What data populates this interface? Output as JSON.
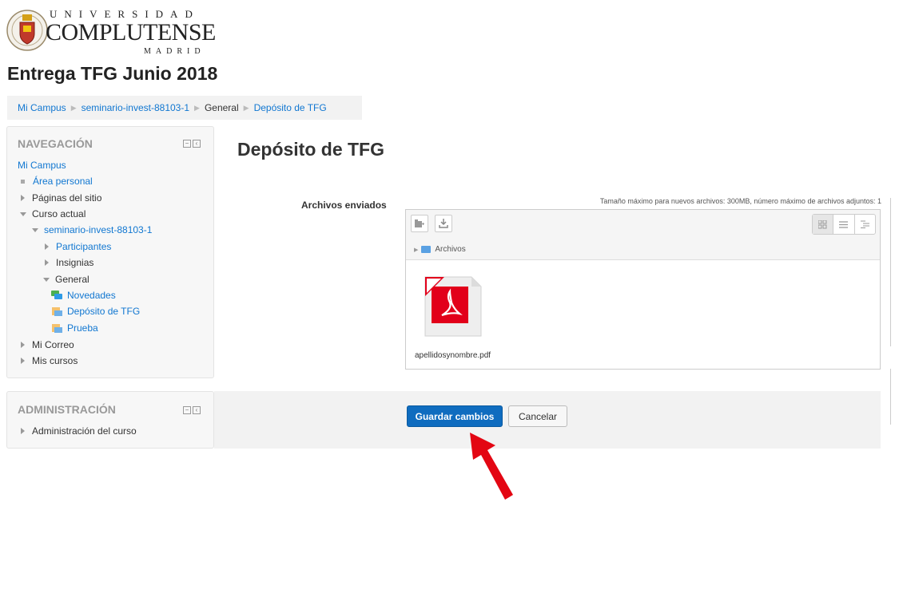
{
  "header": {
    "logo_line1": "UNIVERSIDAD",
    "logo_line2": "COMPLUTENSE",
    "logo_line3": "MADRID",
    "page_title": "Entrega TFG Junio 2018"
  },
  "breadcrumb": {
    "items": [
      "Mi Campus",
      "seminario-invest-88103-1",
      "General",
      "Depósito de TFG"
    ]
  },
  "navigation": {
    "title": "NAVEGACIÓN",
    "items": [
      {
        "label": "Mi Campus"
      },
      {
        "label": "Área personal"
      },
      {
        "label": "Páginas del sitio"
      },
      {
        "label": "Curso actual"
      },
      {
        "label": "seminario-invest-88103-1"
      },
      {
        "label": "Participantes"
      },
      {
        "label": "Insignias"
      },
      {
        "label": "General"
      },
      {
        "label": "Novedades",
        "icon": "forum-icon"
      },
      {
        "label": "Depósito de TFG",
        "icon": "assignment-icon"
      },
      {
        "label": "Prueba",
        "icon": "assignment-icon"
      },
      {
        "label": "Mi Correo"
      },
      {
        "label": "Mis cursos"
      }
    ]
  },
  "administration": {
    "title": "ADMINISTRACIÓN",
    "items": [
      {
        "label": "Administración del curso"
      }
    ]
  },
  "main": {
    "heading": "Depósito de TFG",
    "form_label": "Archivos enviados",
    "max_info": "Tamaño máximo para nuevos archivos: 300MB, número máximo de archivos adjuntos: 1",
    "path_label": "Archivos",
    "file_name": "apellidosynombre.pdf",
    "save_label": "Guardar cambios",
    "cancel_label": "Cancelar"
  },
  "colors": {
    "accent": "#0f6cbf",
    "link": "#1177d1",
    "annotation_arrow": "#e30613",
    "pdf_red": "#e2001a"
  }
}
